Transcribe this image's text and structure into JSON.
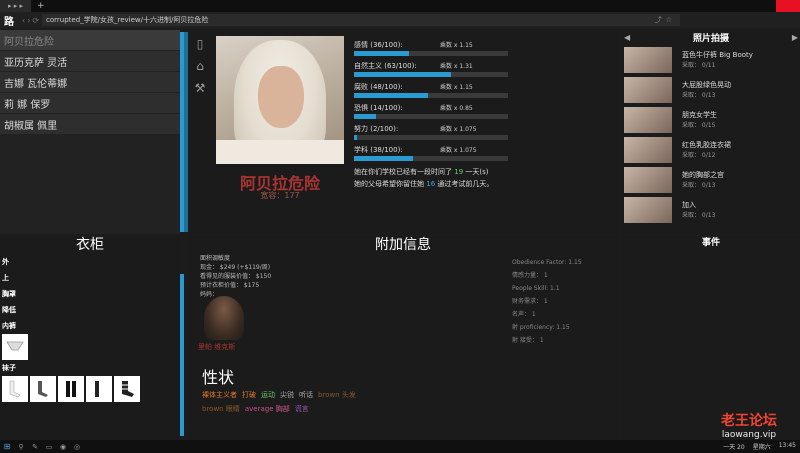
{
  "browser": {
    "tab_title": "▸ ▸ ▸",
    "new_tab": "+",
    "logo": "路",
    "url": "corrupted_学院/女孩_review/十六进制/阿贝拉危险"
  },
  "characters": {
    "items": [
      {
        "label": "阿贝拉危险",
        "active": true
      },
      {
        "label": "亚历克萨 灵活"
      },
      {
        "label": "吉娜 瓦伦蒂娜"
      },
      {
        "label": "莉 娜 保罗"
      },
      {
        "label": "胡椒属 佩里"
      }
    ]
  },
  "profile": {
    "name": "阿贝拉危险",
    "subtitle": "宽容：177",
    "stats": [
      {
        "label": "感情 (36/100):",
        "mult": "乘数 x 1.15",
        "value": 36
      },
      {
        "label": "自然主义 (63/100):",
        "mult": "乘数 x 1.31",
        "value": 63
      },
      {
        "label": "腐败 (48/100):",
        "mult": "乘数 x 1.15",
        "value": 48
      },
      {
        "label": "恐惧 (14/100):",
        "mult": "乘数 x 0.85",
        "value": 14
      },
      {
        "label": "努力 (2/100):",
        "mult": "乘数 x 1.075",
        "value": 2
      },
      {
        "label": "学科 (38/100):",
        "mult": "乘数 x 1.075",
        "value": 38
      }
    ],
    "desc_line1_prefix": "她在你们学校已经有一段时间了 ",
    "desc_days": "19",
    "desc_line1_suffix": " 一天(s)",
    "desc_line2_prefix": "她的父母希望你留住她 ",
    "desc_days2": "16",
    "desc_line2_suffix": " 通过考试前几天。"
  },
  "photos": {
    "title": "照片拍摄",
    "prev": "◀",
    "next": "▶",
    "items": [
      {
        "name": "蓝色牛仔裤 Big Booty",
        "count": "采取： 0/11"
      },
      {
        "name": "大屁股绿色晃动",
        "count": "采取： 0/13"
      },
      {
        "name": "朋克女学生",
        "count": "采取： 0/15"
      },
      {
        "name": "红色乳胶连衣裙",
        "count": "采取： 0/12"
      },
      {
        "name": "她的胸部之宫",
        "count": "采取： 0/13"
      },
      {
        "name": "加入",
        "count": "采取： 0/13"
      }
    ]
  },
  "wardrobe": {
    "title": "衣柜",
    "categories": [
      "外",
      "上",
      "胸罩",
      "降低",
      "内裤",
      "袜子"
    ]
  },
  "extra": {
    "title": "附加信息",
    "left_lines": [
      "面积调敏度",
      "现金： $249 (+$119/周)",
      "看得见的服装价值： $150",
      "预计衣柜价值： $175",
      "妈妈："
    ],
    "mother_name": "里帕 维克斯",
    "right_lines": [
      "Obedience Factor: 1.15",
      "情感力量： 1",
      "People Skill: 1.1",
      "财务需求： 1",
      "名声： 1",
      "射 proficiency: 1.15",
      "射 接受： 1"
    ],
    "traits_title": "性状",
    "traits": [
      {
        "label": "裸体主义者",
        "color": "#e07a2a"
      },
      {
        "label": "打破",
        "color": "#e07a2a"
      },
      {
        "label": "运动",
        "color": "#6c6"
      },
      {
        "label": "尖锐",
        "color": "#aaa"
      },
      {
        "label": "听话",
        "color": "#aaa"
      },
      {
        "label": "brown 头发",
        "color": "#8a5a2a"
      },
      {
        "label": "brown 眼睛",
        "color": "#8a5a2a"
      },
      {
        "label": "average 胸部",
        "color": "#c9508c"
      },
      {
        "label": "谎言",
        "color": "#9b59b6"
      }
    ]
  },
  "events": {
    "title": "事件"
  },
  "watermark": {
    "line1": "老王论坛",
    "line2": "laowang.vip"
  },
  "taskbar": {
    "date": "一天 20",
    "weekday": "星期六",
    "time": "13:45"
  }
}
